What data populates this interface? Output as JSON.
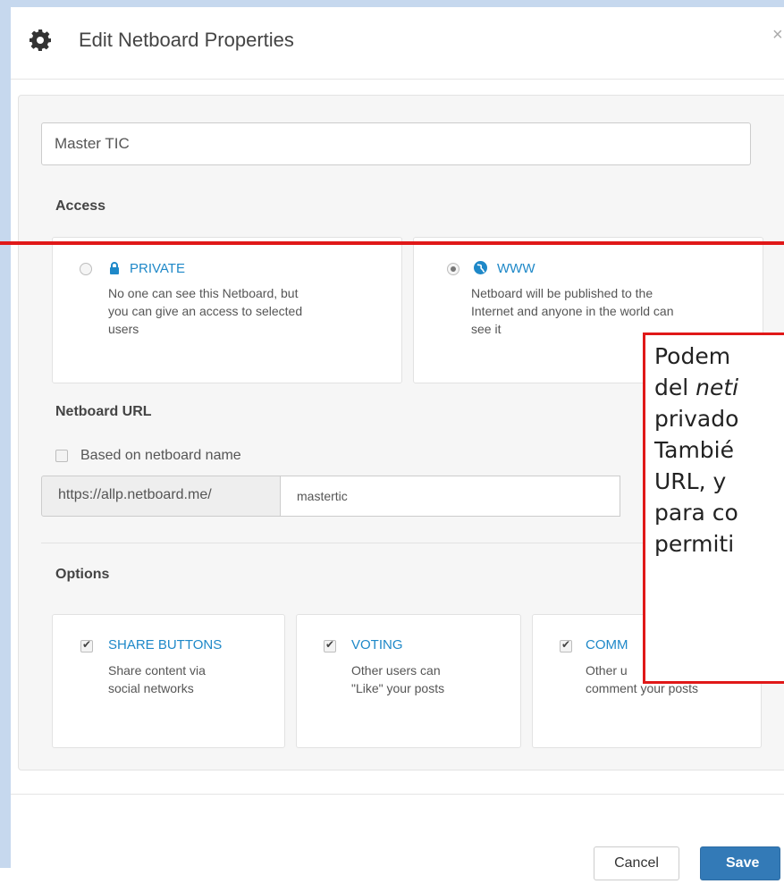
{
  "dialog": {
    "title": "Edit Netboard Properties",
    "close_label": "×"
  },
  "name_field": {
    "value": "Master TIC"
  },
  "access": {
    "label": "Access",
    "options": [
      {
        "title": "PRIVATE",
        "icon": "lock-icon",
        "selected": false,
        "desc": [
          "No one can see this Netboard, but",
          "you can give an access to selected",
          "users"
        ]
      },
      {
        "title": "WWW",
        "icon": "globe-icon",
        "selected": true,
        "desc": [
          "Netboard will be published to the",
          "Internet and anyone in the world can",
          "see it"
        ]
      }
    ]
  },
  "url": {
    "label": "Netboard URL",
    "based_on_name_label": "Based on netboard name",
    "based_on_name_checked": false,
    "prefix": "https://allp.netboard.me/",
    "value": "mastertic"
  },
  "options": {
    "label": "Options",
    "items": [
      {
        "title": "SHARE BUTTONS",
        "checked": true,
        "desc": [
          "Share content via",
          "social networks"
        ]
      },
      {
        "title": "VOTING",
        "checked": true,
        "desc": [
          "Other users can",
          "\"Like\" your posts"
        ]
      },
      {
        "title": "COMM",
        "checked": true,
        "desc": [
          "Other u",
          "comment your posts"
        ]
      }
    ]
  },
  "footer": {
    "cancel_label": "Cancel",
    "save_label": "Save"
  },
  "annotation": {
    "lines": [
      "Podem",
      "del ",
      "privado",
      "Tambié",
      "URL, y",
      "para co",
      "permiti"
    ],
    "italic_fragment": "neti"
  },
  "colors": {
    "accent": "#1e88c8",
    "primary_button": "#337ab7",
    "annotation_red": "#e01818"
  }
}
